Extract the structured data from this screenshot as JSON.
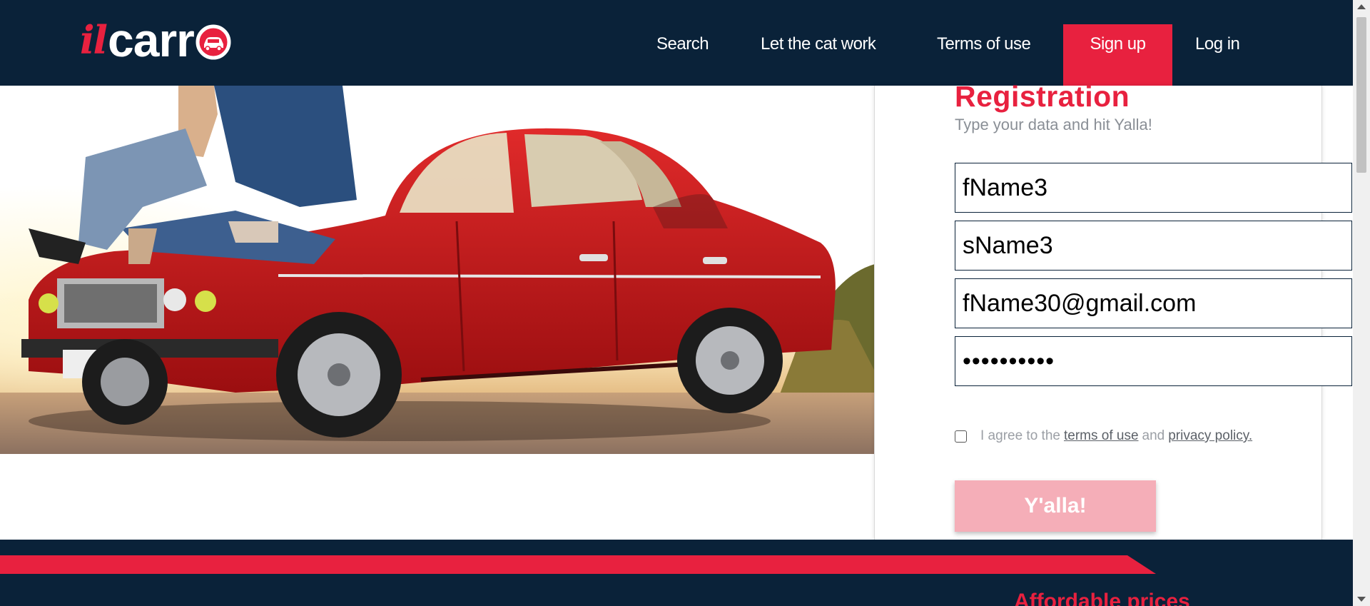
{
  "header": {
    "logo": {
      "part1": "il",
      "part2": "carr"
    },
    "nav": {
      "search": "Search",
      "let_cat_work": "Let the cat work",
      "terms": "Terms of use",
      "sign_up": "Sign up",
      "log_in": "Log in"
    }
  },
  "registration": {
    "title": "Registration",
    "subtitle": "Type your data and hit Yalla!",
    "first_name": "fName3",
    "last_name": "sName3",
    "email": "fName30@gmail.com",
    "password": "••••••••••",
    "agree_prefix": "I agree to the",
    "terms_link": "terms of use",
    "and_text": "and",
    "privacy_link": "privacy policy.",
    "submit": "Y'alla!"
  },
  "footer": {
    "tagline": "Affordable prices"
  },
  "colors": {
    "navy": "#0a2239",
    "accent_red": "#e8213f",
    "disabled_button": "#f5aeb8"
  },
  "icons": {
    "logo_car": "car-in-circle-icon",
    "checkbox": "checkbox-unchecked",
    "scroll_up": "chevron-up-icon",
    "scroll_down": "chevron-down-icon"
  }
}
